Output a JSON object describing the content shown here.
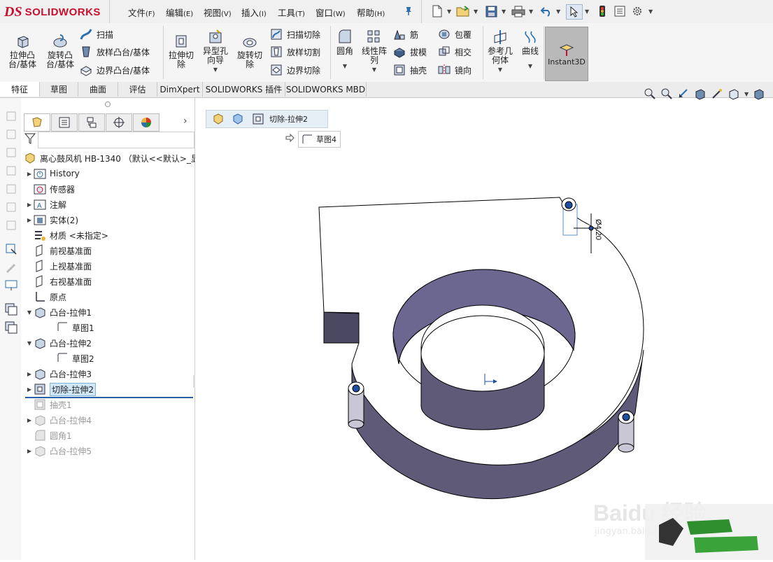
{
  "app": {
    "logo_prefix": "DS",
    "logo_text": "SOLIDWORKS",
    "brand_color": "#c8102e"
  },
  "menu": [
    {
      "label": "文件",
      "key": "(F)"
    },
    {
      "label": "编辑",
      "key": "(E)"
    },
    {
      "label": "视图",
      "key": "(V)"
    },
    {
      "label": "插入",
      "key": "(I)"
    },
    {
      "label": "工具",
      "key": "(T)"
    },
    {
      "label": "窗口",
      "key": "(W)"
    },
    {
      "label": "帮助",
      "key": "(H)"
    }
  ],
  "ribbon": {
    "extrude_boss": "拉伸凸台/基体",
    "revolve_boss": "旋转凸台/基体",
    "sweep": "扫描",
    "loft_boss": "放样凸台/基体",
    "boundary_boss": "边界凸台/基体",
    "extrude_cut": "拉伸切除",
    "hole_wizard": "异型孔向导",
    "revolve_cut": "旋转切除",
    "swept_cut": "扫描切除",
    "lofted_cut": "放样切割",
    "boundary_cut": "边界切除",
    "fillet": "圆角",
    "linear_pattern": "线性阵列",
    "rib": "筋",
    "draft": "拔模",
    "shell": "抽壳",
    "wrap": "包覆",
    "intersect": "相交",
    "mirror": "镜向",
    "ref_geometry": "参考几何体",
    "curves": "曲线",
    "instant3d": "Instant3D"
  },
  "tabs": [
    "特征",
    "草图",
    "曲面",
    "评估",
    "DimXpert",
    "SOLIDWORKS 插件",
    "SOLIDWORKS MBD"
  ],
  "tree": {
    "root": "离心鼓风机 HB-1340 （默认<<默认>_显",
    "items": [
      {
        "label": "History"
      },
      {
        "label": "传感器"
      },
      {
        "label": "注解"
      },
      {
        "label": "实体(2)"
      },
      {
        "label": "材质 <未指定>"
      },
      {
        "label": "前视基准面"
      },
      {
        "label": "上视基准面"
      },
      {
        "label": "右视基准面"
      },
      {
        "label": "原点"
      },
      {
        "label": "凸台-拉伸1"
      },
      {
        "label": "草图1"
      },
      {
        "label": "凸台-拉伸2"
      },
      {
        "label": "草图2"
      },
      {
        "label": "凸台-拉伸3"
      },
      {
        "label": "切除-拉伸2"
      },
      {
        "label": "抽壳1"
      },
      {
        "label": "凸台-拉伸4"
      },
      {
        "label": "圆角1"
      },
      {
        "label": "凸台-拉伸5"
      }
    ]
  },
  "breadcrumb": {
    "feature": "切除-拉伸2",
    "sketch": "草图4"
  },
  "dimension": {
    "text": "Ø4.20"
  },
  "watermark": {
    "text": "Baidu 经验",
    "url": "jingyan.baidu.com"
  }
}
